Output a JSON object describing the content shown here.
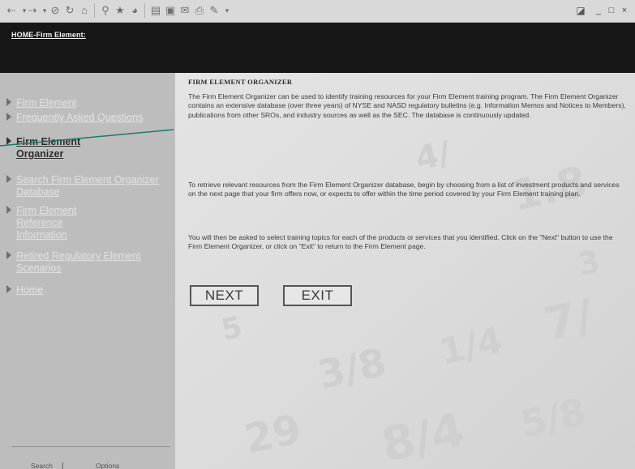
{
  "toolbar": {
    "icons": [
      "back-icon",
      "forward-icon",
      "stop-icon",
      "refresh-icon",
      "home-icon",
      "search-icon",
      "favorites-icon",
      "history-icon",
      "channels-icon",
      "fullscreen-icon",
      "mail-icon",
      "print-icon",
      "edit-icon"
    ],
    "window_controls": [
      "_",
      "□",
      "×"
    ]
  },
  "banner": {
    "breadcrumb": "HOME-Firm Element:"
  },
  "sidebar": {
    "items": [
      {
        "label": "Firm Element",
        "active": false
      },
      {
        "label": "Frequently Asked Questions",
        "active": false
      },
      {
        "label": "Firm Element Organizer",
        "active": true
      },
      {
        "label": "Search Firm Element Organizer Database",
        "active": false
      },
      {
        "label": "Firm Element Reference Information",
        "active": false
      },
      {
        "label": "Retired Regulatory Element Scenarios",
        "active": false
      },
      {
        "label": "Home",
        "active": false
      }
    ],
    "footer": {
      "search": "Search",
      "separator": "|",
      "options": "Options"
    }
  },
  "main": {
    "heading": "FIRM ELEMENT ORGANIZER",
    "paragraphs": [
      "The Firm Element Organizer can be used to identify training resources for your Firm Element training program. The Firm Element Organizer contains an extensive database (over three years) of NYSE and NASD regulatory bulletins (e.g. Information Memos and Notices to Members), publications from other SROs, and industry sources as well as the SEC. The database is continuously updated.",
      "To retrieve relevant resources from the Firm Element Organizer database, begin by choosing from a list of investment products and services on the next page that your firm offers now, or expects to offer within the time period covered by your Firm Element training plan.",
      "You will then be asked to select training topics for each of the products or services that you identified. Click on the \"Next\" button to use the Firm Element Organizer, or click on \"Exit\" to return to the Firm Element page."
    ],
    "buttons": {
      "next": "NEXT",
      "exit": "EXIT"
    }
  },
  "colors": {
    "banner": "#171717",
    "sidebar": "#bdbdbd",
    "content": "#dedede",
    "callout": "#1e7a66"
  }
}
